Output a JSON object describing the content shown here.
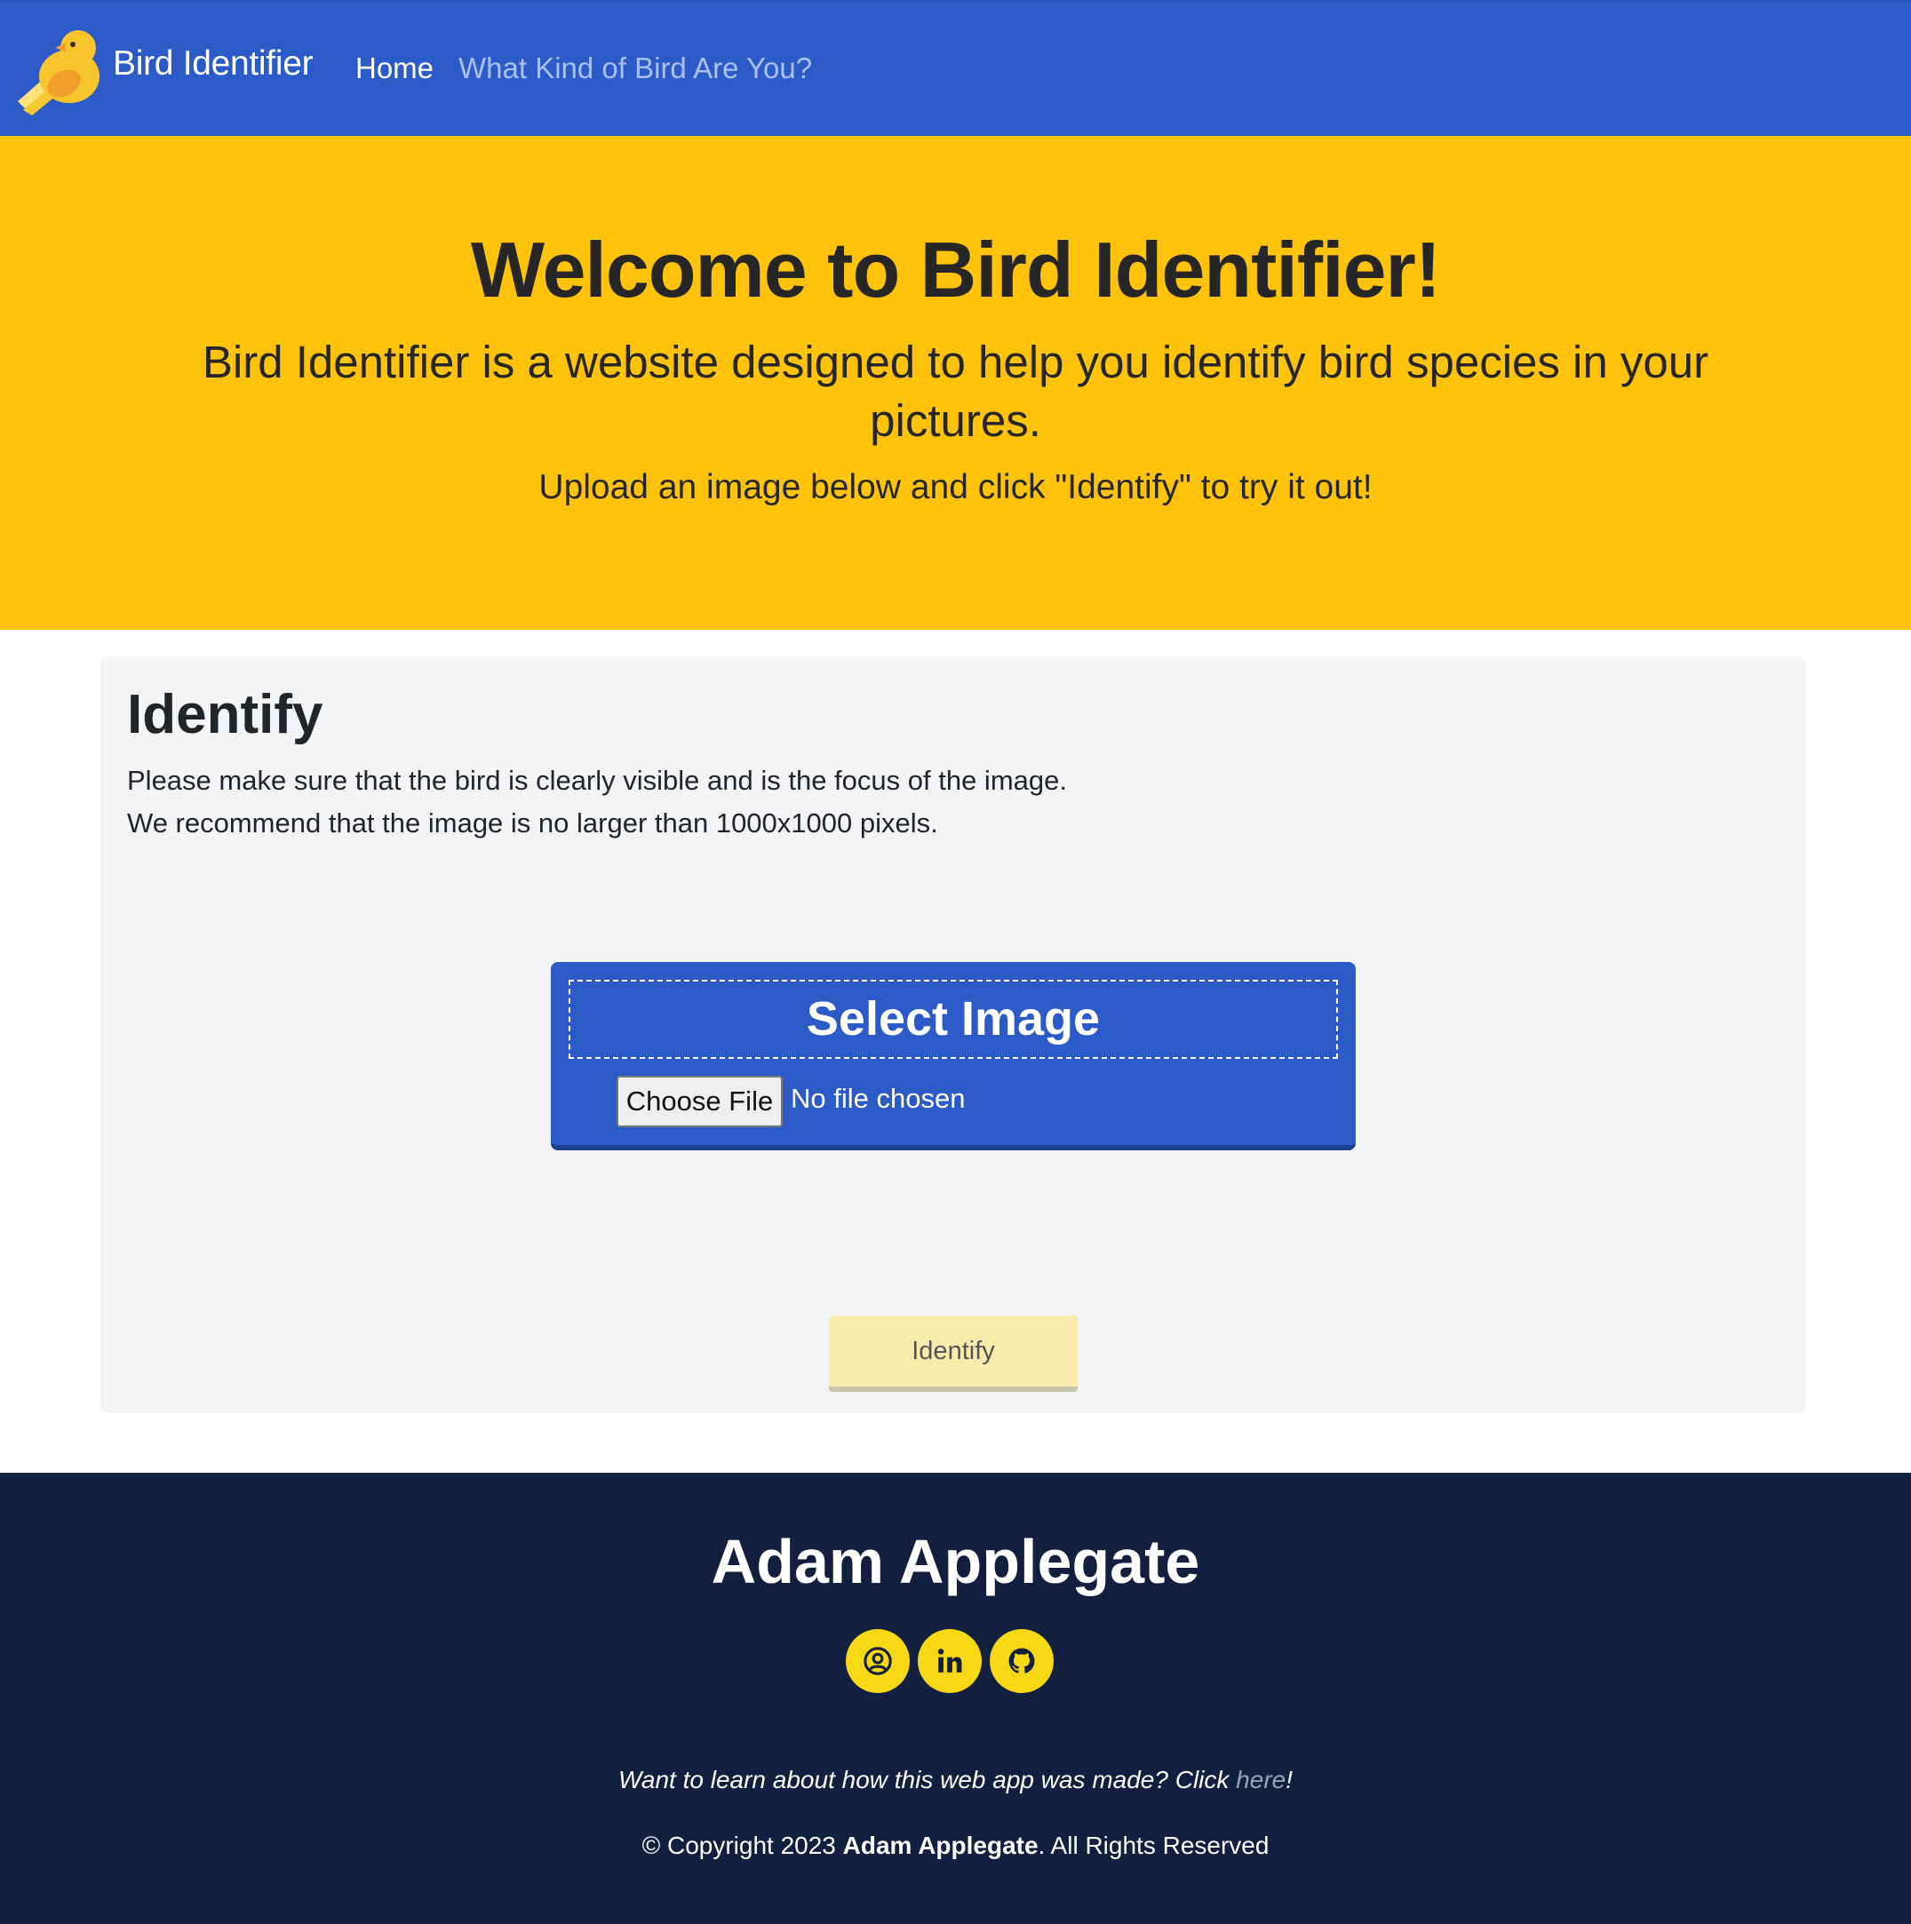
{
  "navbar": {
    "brand": "Bird Identifier",
    "links": [
      {
        "label": "Home",
        "active": true
      },
      {
        "label": "What Kind of Bird Are You?",
        "active": false
      }
    ],
    "background": "#2c5bc7"
  },
  "hero": {
    "title": "Welcome to Bird Identifier!",
    "subtitle": "Bird Identifier is a website designed to help you identify bird species in your pictures.",
    "cta": "Upload an image below and click \"Identify\" to try it out!",
    "background": "#ffc30b"
  },
  "identify": {
    "title": "Identify",
    "note1": "Please make sure that the bird is clearly visible and is the focus of the image.",
    "note2": "We recommend that the image is no larger than 1000x1000 pixels.",
    "upload_label": "Select Image",
    "choose_file": "Choose File",
    "file_status": "No file chosen",
    "identify_button": "Identify"
  },
  "footer": {
    "name": "Adam Applegate",
    "social_icons": [
      "profile-icon",
      "linkedin-icon",
      "github-icon"
    ],
    "learn_prefix": "Want to learn about how this web app was made? Click ",
    "learn_link": "here",
    "learn_suffix": "!",
    "copyright_prefix": "© Copyright 2023 ",
    "copyright_name": "Adam Applegate",
    "copyright_suffix": ". All Rights Reserved",
    "background": "#131f3f",
    "accent": "#f6d814"
  }
}
